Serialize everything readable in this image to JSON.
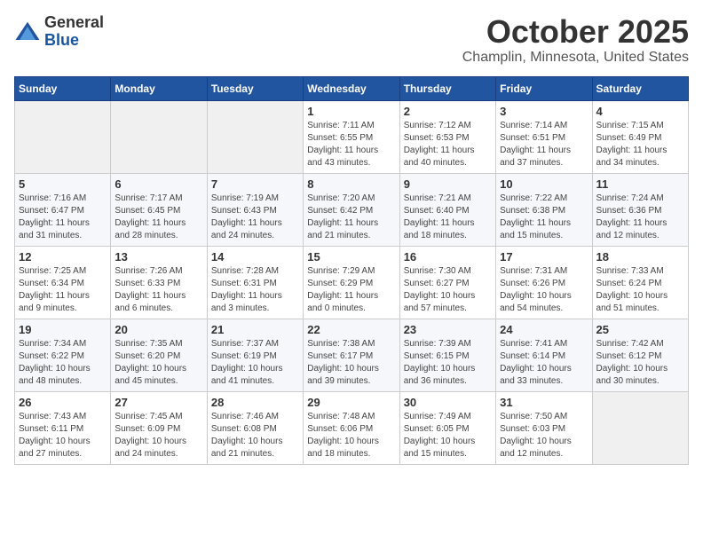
{
  "logo": {
    "general": "General",
    "blue": "Blue"
  },
  "title": "October 2025",
  "location": "Champlin, Minnesota, United States",
  "headers": [
    "Sunday",
    "Monday",
    "Tuesday",
    "Wednesday",
    "Thursday",
    "Friday",
    "Saturday"
  ],
  "weeks": [
    [
      {
        "day": "",
        "info": ""
      },
      {
        "day": "",
        "info": ""
      },
      {
        "day": "",
        "info": ""
      },
      {
        "day": "1",
        "info": "Sunrise: 7:11 AM\nSunset: 6:55 PM\nDaylight: 11 hours\nand 43 minutes."
      },
      {
        "day": "2",
        "info": "Sunrise: 7:12 AM\nSunset: 6:53 PM\nDaylight: 11 hours\nand 40 minutes."
      },
      {
        "day": "3",
        "info": "Sunrise: 7:14 AM\nSunset: 6:51 PM\nDaylight: 11 hours\nand 37 minutes."
      },
      {
        "day": "4",
        "info": "Sunrise: 7:15 AM\nSunset: 6:49 PM\nDaylight: 11 hours\nand 34 minutes."
      }
    ],
    [
      {
        "day": "5",
        "info": "Sunrise: 7:16 AM\nSunset: 6:47 PM\nDaylight: 11 hours\nand 31 minutes."
      },
      {
        "day": "6",
        "info": "Sunrise: 7:17 AM\nSunset: 6:45 PM\nDaylight: 11 hours\nand 28 minutes."
      },
      {
        "day": "7",
        "info": "Sunrise: 7:19 AM\nSunset: 6:43 PM\nDaylight: 11 hours\nand 24 minutes."
      },
      {
        "day": "8",
        "info": "Sunrise: 7:20 AM\nSunset: 6:42 PM\nDaylight: 11 hours\nand 21 minutes."
      },
      {
        "day": "9",
        "info": "Sunrise: 7:21 AM\nSunset: 6:40 PM\nDaylight: 11 hours\nand 18 minutes."
      },
      {
        "day": "10",
        "info": "Sunrise: 7:22 AM\nSunset: 6:38 PM\nDaylight: 11 hours\nand 15 minutes."
      },
      {
        "day": "11",
        "info": "Sunrise: 7:24 AM\nSunset: 6:36 PM\nDaylight: 11 hours\nand 12 minutes."
      }
    ],
    [
      {
        "day": "12",
        "info": "Sunrise: 7:25 AM\nSunset: 6:34 PM\nDaylight: 11 hours\nand 9 minutes."
      },
      {
        "day": "13",
        "info": "Sunrise: 7:26 AM\nSunset: 6:33 PM\nDaylight: 11 hours\nand 6 minutes."
      },
      {
        "day": "14",
        "info": "Sunrise: 7:28 AM\nSunset: 6:31 PM\nDaylight: 11 hours\nand 3 minutes."
      },
      {
        "day": "15",
        "info": "Sunrise: 7:29 AM\nSunset: 6:29 PM\nDaylight: 11 hours\nand 0 minutes."
      },
      {
        "day": "16",
        "info": "Sunrise: 7:30 AM\nSunset: 6:27 PM\nDaylight: 10 hours\nand 57 minutes."
      },
      {
        "day": "17",
        "info": "Sunrise: 7:31 AM\nSunset: 6:26 PM\nDaylight: 10 hours\nand 54 minutes."
      },
      {
        "day": "18",
        "info": "Sunrise: 7:33 AM\nSunset: 6:24 PM\nDaylight: 10 hours\nand 51 minutes."
      }
    ],
    [
      {
        "day": "19",
        "info": "Sunrise: 7:34 AM\nSunset: 6:22 PM\nDaylight: 10 hours\nand 48 minutes."
      },
      {
        "day": "20",
        "info": "Sunrise: 7:35 AM\nSunset: 6:20 PM\nDaylight: 10 hours\nand 45 minutes."
      },
      {
        "day": "21",
        "info": "Sunrise: 7:37 AM\nSunset: 6:19 PM\nDaylight: 10 hours\nand 41 minutes."
      },
      {
        "day": "22",
        "info": "Sunrise: 7:38 AM\nSunset: 6:17 PM\nDaylight: 10 hours\nand 39 minutes."
      },
      {
        "day": "23",
        "info": "Sunrise: 7:39 AM\nSunset: 6:15 PM\nDaylight: 10 hours\nand 36 minutes."
      },
      {
        "day": "24",
        "info": "Sunrise: 7:41 AM\nSunset: 6:14 PM\nDaylight: 10 hours\nand 33 minutes."
      },
      {
        "day": "25",
        "info": "Sunrise: 7:42 AM\nSunset: 6:12 PM\nDaylight: 10 hours\nand 30 minutes."
      }
    ],
    [
      {
        "day": "26",
        "info": "Sunrise: 7:43 AM\nSunset: 6:11 PM\nDaylight: 10 hours\nand 27 minutes."
      },
      {
        "day": "27",
        "info": "Sunrise: 7:45 AM\nSunset: 6:09 PM\nDaylight: 10 hours\nand 24 minutes."
      },
      {
        "day": "28",
        "info": "Sunrise: 7:46 AM\nSunset: 6:08 PM\nDaylight: 10 hours\nand 21 minutes."
      },
      {
        "day": "29",
        "info": "Sunrise: 7:48 AM\nSunset: 6:06 PM\nDaylight: 10 hours\nand 18 minutes."
      },
      {
        "day": "30",
        "info": "Sunrise: 7:49 AM\nSunset: 6:05 PM\nDaylight: 10 hours\nand 15 minutes."
      },
      {
        "day": "31",
        "info": "Sunrise: 7:50 AM\nSunset: 6:03 PM\nDaylight: 10 hours\nand 12 minutes."
      },
      {
        "day": "",
        "info": ""
      }
    ]
  ]
}
